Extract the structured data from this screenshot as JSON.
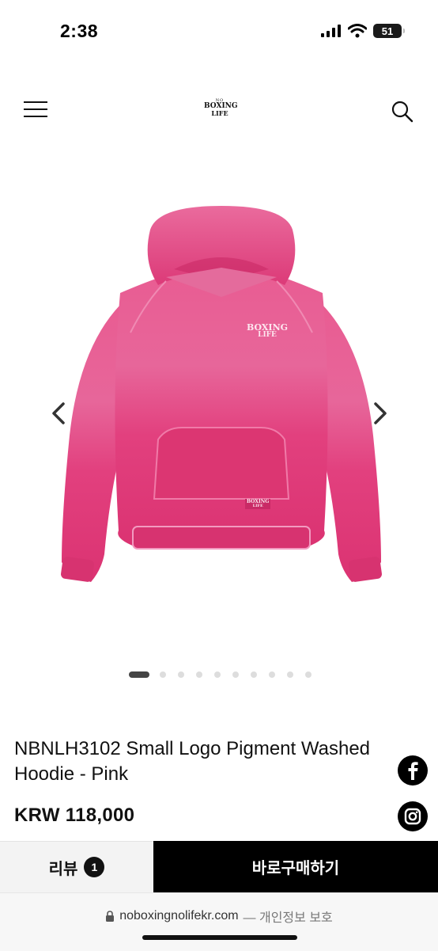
{
  "status_bar": {
    "time": "2:38",
    "battery": "51"
  },
  "header": {
    "logo": {
      "line1": "NO",
      "line2": "BOXING",
      "line3": "LIFE"
    },
    "menu_icon": "hamburger-icon",
    "search_icon": "search-icon"
  },
  "gallery": {
    "image_label": "NBNLH3102 Small Logo Pigment Washed Hoodie - Pink",
    "hoodie_color": "#e2407e",
    "print_logo": {
      "line1": "BOXING",
      "line2": "LIFE"
    },
    "patch_logo": {
      "line1": "BOXING",
      "line2": "LIFE"
    },
    "total_images": 10,
    "current_index": 0
  },
  "product": {
    "title": "NBNLH3102 Small Logo Pigment Washed Hoodie - Pink",
    "price": "KRW 118,000"
  },
  "actions": {
    "review_label": "리뷰",
    "review_count": "1",
    "buy_label": "바로구매하기"
  },
  "browser": {
    "url": "noboxingnolifekr.com",
    "note": "— 개인정보 보호"
  },
  "colors": {
    "accent": "#000000",
    "hoodie": "#e2407e",
    "review_bg": "#f3f3f3"
  }
}
